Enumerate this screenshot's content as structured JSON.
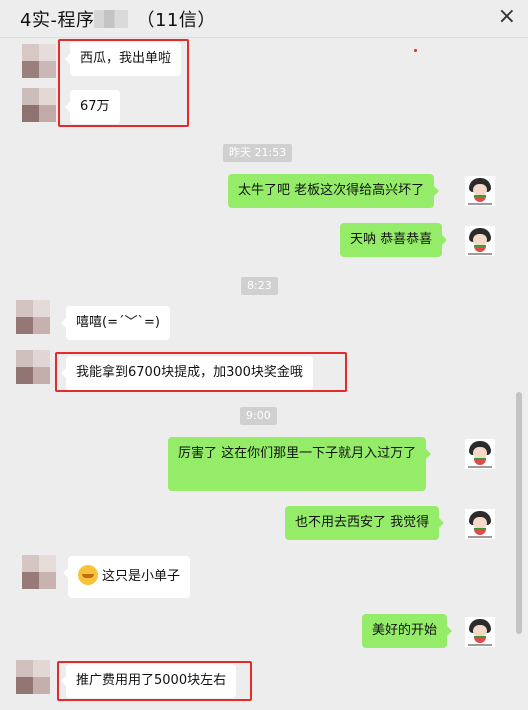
{
  "header": {
    "title_prefix": "4实-程序",
    "title_suffix": "（11信）",
    "close_glyph": "×"
  },
  "messages": [
    {
      "side": "left",
      "text": "西瓜，我出单啦"
    },
    {
      "side": "left",
      "text": "67万"
    },
    {
      "side": "right",
      "text": "太牛了吧  老板这次得给高兴坏了"
    },
    {
      "side": "right",
      "text": "天呐  恭喜恭喜"
    },
    {
      "side": "left",
      "text": "嘻嘻(=´﹀`=)"
    },
    {
      "side": "left",
      "text": "我能拿到6700块提成，加300块奖金哦"
    },
    {
      "side": "right",
      "text": "厉害了   这在你们那里一下子就月入过万了"
    },
    {
      "side": "right",
      "text": "也不用去西安了  我觉得"
    },
    {
      "side": "left",
      "text": "这只是小单子",
      "emoji": "awkward-face"
    },
    {
      "side": "right",
      "text": "美好的开始"
    },
    {
      "side": "left",
      "text": "推广费用用了5000块左右"
    }
  ],
  "timestamps": [
    "昨天 21:53",
    "8:23",
    "9:00"
  ],
  "colors": {
    "background": "#ededed",
    "bubble_right": "#95ec69",
    "bubble_left": "#ffffff",
    "highlight_box": "#e42b2b",
    "timestamp_bg": "#d0d0d0"
  }
}
